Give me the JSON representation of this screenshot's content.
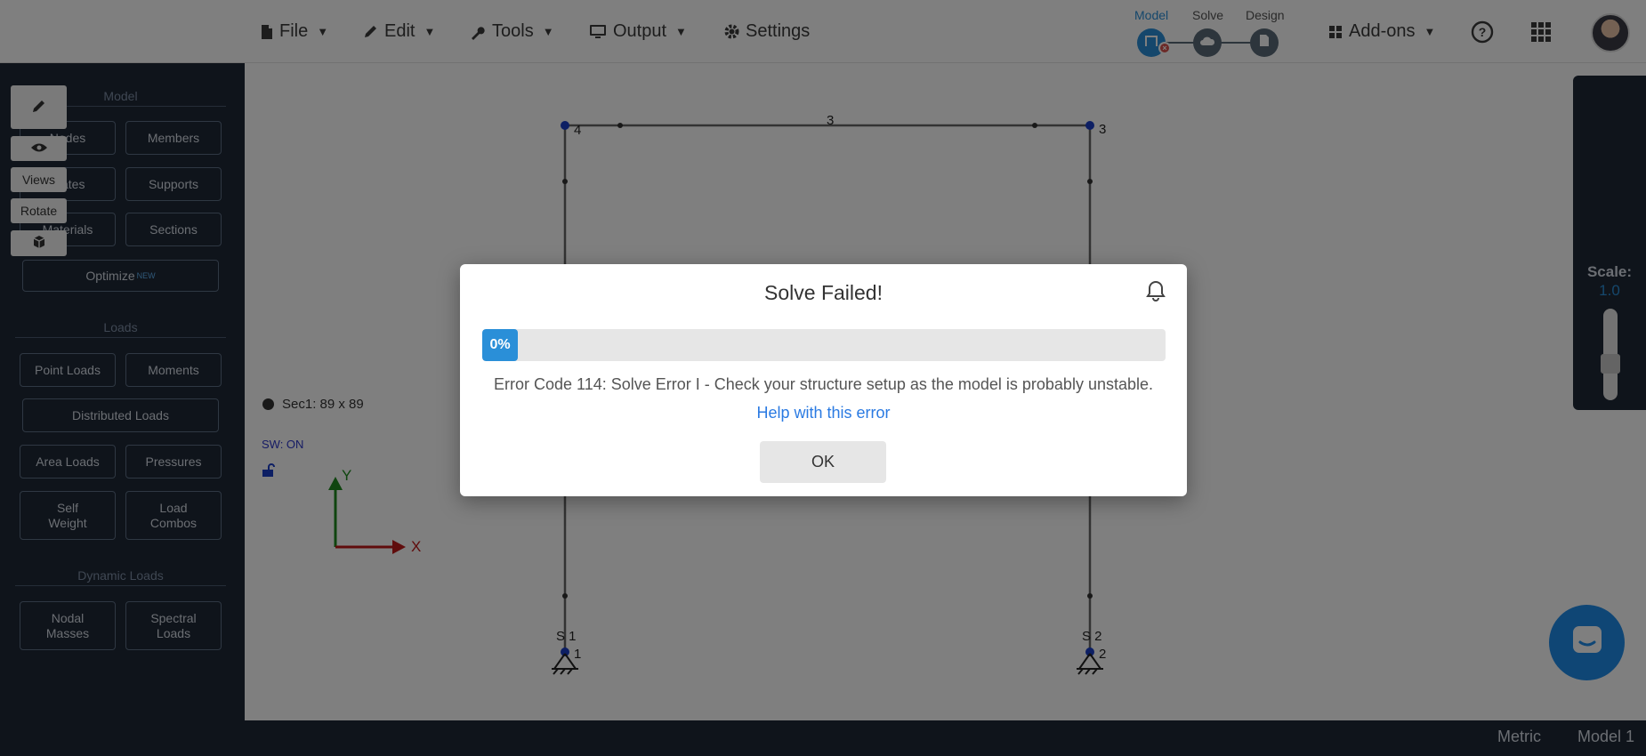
{
  "toolbar": {
    "file_label": "File",
    "edit_label": "Edit",
    "tools_label": "Tools",
    "output_label": "Output",
    "settings_label": "Settings",
    "addons_label": "Add-ons",
    "workflow_steps": [
      "Model",
      "Solve",
      "Design"
    ],
    "icons": [
      "file-icon",
      "pencil-icon",
      "wrench-icon",
      "monitor-icon",
      "gear-icon",
      "grid-icon",
      "help-icon",
      "apps-icon"
    ]
  },
  "sidebar": {
    "model_heading": "Model",
    "loads_heading": "Loads",
    "dynamic_heading": "Dynamic Loads",
    "nodes": "Nodes",
    "members": "Members",
    "plates": "Plates",
    "supports": "Supports",
    "materials": "Materials",
    "sections": "Sections",
    "optimize": "Optimize",
    "optimize_badge": "NEW",
    "point_loads": "Point Loads",
    "moments": "Moments",
    "distributed_loads": "Distributed Loads",
    "area_loads": "Area Loads",
    "pressures": "Pressures",
    "self_weight_1": "Self",
    "self_weight_2": "Weight",
    "load_combos_1": "Load",
    "load_combos_2": "Combos",
    "nodal_masses_1": "Nodal",
    "nodal_masses_2": "Masses",
    "spectral_loads_1": "Spectral",
    "spectral_loads_2": "Loads"
  },
  "canvas": {
    "section_info": "Sec1: 89 x 89",
    "self_weight_status": "SW: ON",
    "axis_y": "Y",
    "axis_x": "X",
    "node_labels": [
      "1",
      "2",
      "3",
      "4"
    ],
    "member_label": "3",
    "support_labels": [
      "S 1",
      "S 2"
    ]
  },
  "right_toolbar": {
    "views": "Views",
    "rotate": "Rotate",
    "scale_label": "Scale:",
    "scale_value": "1.0"
  },
  "statusbar": {
    "units": "Metric",
    "model_name": "Model 1"
  },
  "modal": {
    "title": "Solve Failed!",
    "progress_text": "0%",
    "progress_fraction": 0,
    "error_message": "Error Code 114: Solve Error I - Check your structure setup as the model is probably unstable.",
    "help_link": "Help with this error",
    "ok_label": "OK"
  },
  "colors": {
    "accent": "#2a8fd8",
    "sidebar_bg": "#1e2836",
    "error": "#d9534f",
    "link": "#2a7ae2"
  }
}
